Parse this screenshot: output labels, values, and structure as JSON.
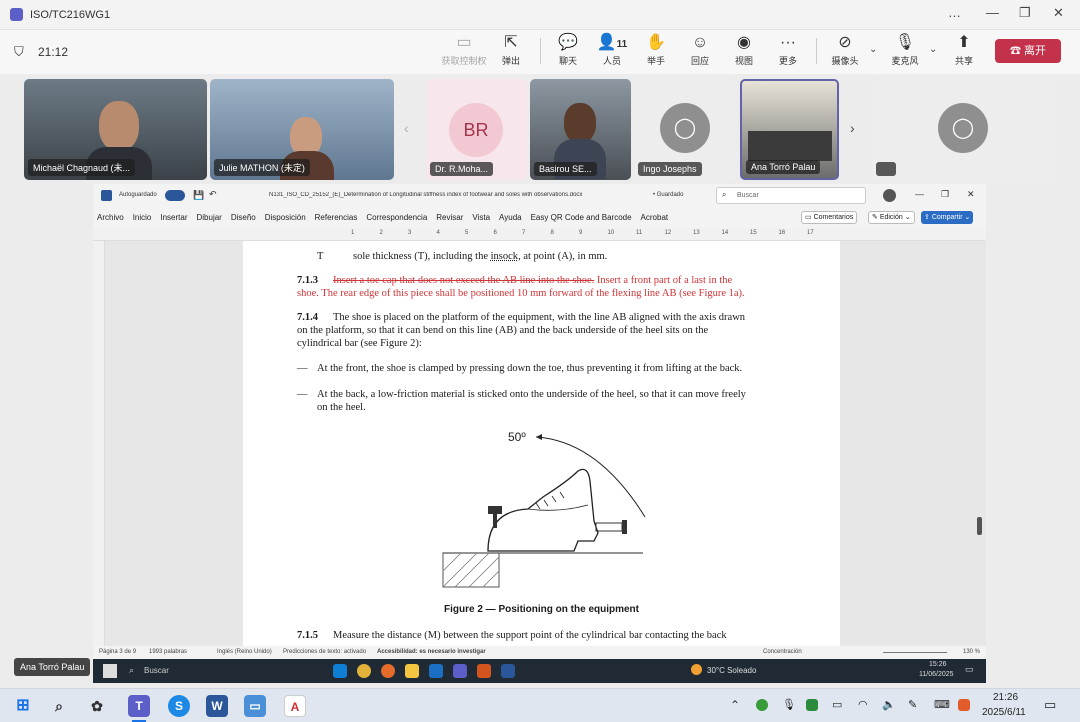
{
  "teams": {
    "window_title": "ISO/TC216WG1",
    "timer": "21:12",
    "toolbar": {
      "take_control": "获取控制权",
      "popout": "弹出",
      "chat": "聊天",
      "people": "人员",
      "people_count": "11",
      "raise_hand": "举手",
      "react": "回应",
      "view": "视图",
      "more": "更多",
      "camera": "摄像头",
      "mic": "麦克风",
      "share": "共享",
      "leave": "离开"
    },
    "participants": [
      {
        "name": "Michaël Chagnaud (未..."
      },
      {
        "name": "Julie MATHON (未定)"
      },
      {
        "name": "Dr. R.Moha...",
        "initials": "BR"
      },
      {
        "name": "Basirou SE..."
      },
      {
        "name": "Ingo Josephs"
      },
      {
        "name": "Ana Torró Palau"
      },
      {
        "name": ""
      }
    ],
    "presenter_label": "Ana Torró Palau"
  },
  "word": {
    "autosave": "Autoguardado",
    "filename": "N131_ISO_CD_25152_(E)_Determination of Longitudinal stiffness index of footwear and soles with observations.docx",
    "saved": "• Guardado",
    "search": "Buscar",
    "menu": [
      "Archivo",
      "Inicio",
      "Insertar",
      "Dibujar",
      "Diseño",
      "Disposición",
      "Referencias",
      "Correspondencia",
      "Revisar",
      "Vista",
      "Ayuda",
      "Easy QR Code and Barcode",
      "Acrobat"
    ],
    "comments": "Comentarios",
    "editing": "Edición",
    "share": "Compartir",
    "ruler_numbers": [
      "1",
      "2",
      "3",
      "4",
      "5",
      "6",
      "7",
      "8",
      "9",
      "10",
      "11",
      "12",
      "13",
      "14",
      "15",
      "16",
      "17"
    ],
    "status": {
      "page": "Página 3 de 9",
      "words": "1993 palabras",
      "language": "Inglés (Reino Unido)",
      "predictions": "Predicciones de texto: activado",
      "accessibility": "Accesibilidad: es necesario investigar",
      "focus": "Concentración",
      "zoom": "130 %"
    }
  },
  "doc": {
    "line_t_label": "T",
    "line_t_text_a": "sole thickness (T), including the ",
    "line_t_insock": "insock",
    "line_t_text_b": ", at point (A), in mm.",
    "c713_num": "7.1.3",
    "c713_deleted": "Insert a toe cap that does not exceed the AB line into the shoe.",
    "c713_inserted_a": " Insert a front part of a last in the",
    "c713_inserted_b": "shoe. The rear edge of this piece shall be positioned 10 mm forward of the flexing line AB (see Figure 1a).",
    "c714_num": "7.1.4",
    "c714_l1": "The shoe is placed on the platform of the equipment, with the line AB aligned with the axis drawn",
    "c714_l2": "on the platform, so that it can bend on this line (AB) and the back underside of the heel sits on the",
    "c714_l3": "cylindrical bar (see Figure 2):",
    "dash": "—",
    "bullet1": "At the front, the shoe is clamped by pressing down the toe, thus preventing it from lifting at the back.",
    "bullet2_l1": "At the back, a low-friction material is sticked onto the underside of the heel, so that it can move freely",
    "bullet2_l2": "on the heel.",
    "figure_angle": "50º",
    "figure_caption": "Figure 2 — Positioning on the equipment",
    "c715_num": "7.1.5",
    "c715_l1": "Measure the distance (M) between the support point of the cylindrical bar contacting the back"
  },
  "remote_taskbar": {
    "search": "Buscar",
    "weather": "30°C  Soleado",
    "time": "15:26",
    "date": "11/06/2025"
  },
  "taskbar": {
    "time": "21:26",
    "date": "2025/6/11"
  }
}
